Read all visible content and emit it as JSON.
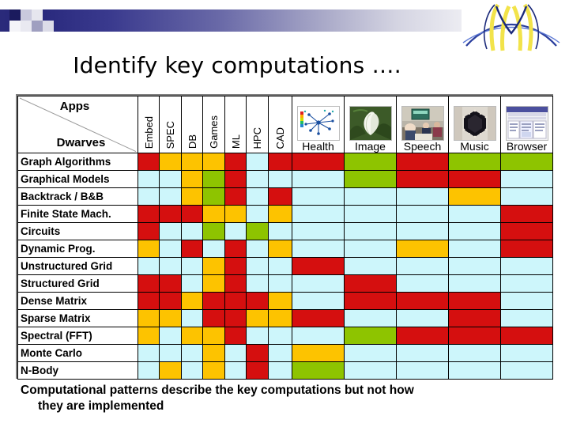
{
  "slide": {
    "title": "Identify key computations ….",
    "caption_line1": "Computational patterns describe the key computations but not how",
    "caption_line2": "they are implemented"
  },
  "table": {
    "corner": {
      "apps_label": "Apps",
      "dwarves_label": "Dwarves"
    },
    "text_columns": [
      "Embed",
      "SPEC",
      "DB",
      "Games",
      "ML",
      "HPC",
      "CAD"
    ],
    "image_columns": [
      {
        "label": "Health",
        "icon": "molecular-network-thumbnail"
      },
      {
        "label": "Image",
        "icon": "white-flower-photo-thumbnail"
      },
      {
        "label": "Speech",
        "icon": "meeting-room-photo-thumbnail"
      },
      {
        "label": "Music",
        "icon": "dark-wreath-photo-thumbnail"
      },
      {
        "label": "Browser",
        "icon": "web-browser-window-thumbnail"
      }
    ],
    "rows": [
      "Graph Algorithms",
      "Graphical Models",
      "Backtrack / B&B",
      "Finite State Mach.",
      "Circuits",
      "Dynamic Prog.",
      "Unstructured Grid",
      "Structured Grid",
      "Dense Matrix",
      "Sparse Matrix",
      "Spectral (FFT)",
      "Monte Carlo",
      "N-Body"
    ],
    "legend_colors": {
      "high": "#d50f0f",
      "medium-high": "#fdc300",
      "medium": "#8ec400",
      "low": "#cdf6fb"
    }
  },
  "chart_data": {
    "type": "heatmap",
    "title": "Identify key computations ….",
    "xlabel": "Apps",
    "ylabel": "Dwarves",
    "categories_x": [
      "Embed",
      "SPEC",
      "DB",
      "Games",
      "ML",
      "HPC",
      "CAD",
      "Health",
      "Image",
      "Speech",
      "Music",
      "Browser"
    ],
    "categories_y": [
      "Graph Algorithms",
      "Graphical Models",
      "Backtrack / B&B",
      "Finite State Mach.",
      "Circuits",
      "Dynamic Prog.",
      "Unstructured Grid",
      "Structured Grid",
      "Dense Matrix",
      "Sparse Matrix",
      "Spectral (FFT)",
      "Monte Carlo",
      "N-Body"
    ],
    "value_levels": {
      "high": "#d50f0f",
      "medium-high": "#fdc300",
      "medium": "#8ec400",
      "low": "#cdf6fb"
    },
    "legend": [
      "high",
      "medium-high",
      "medium",
      "low"
    ],
    "grid": true,
    "matrix": [
      [
        "high",
        "medium-high",
        "medium-high",
        "medium-high",
        "high",
        "low",
        "high",
        "high",
        "medium",
        "high",
        "medium",
        "medium"
      ],
      [
        "low",
        "low",
        "medium-high",
        "medium",
        "high",
        "low",
        "low",
        "low",
        "medium",
        "high",
        "high",
        "low"
      ],
      [
        "low",
        "low",
        "medium-high",
        "medium",
        "high",
        "low",
        "high",
        "low",
        "low",
        "low",
        "medium-high",
        "low"
      ],
      [
        "high",
        "high",
        "high",
        "medium-high",
        "medium-high",
        "low",
        "medium-high",
        "low",
        "low",
        "low",
        "low",
        "high"
      ],
      [
        "high",
        "low",
        "low",
        "medium",
        "low",
        "medium",
        "low",
        "low",
        "low",
        "low",
        "low",
        "high"
      ],
      [
        "medium-high",
        "low",
        "high",
        "low",
        "high",
        "low",
        "medium-high",
        "low",
        "low",
        "medium-high",
        "low",
        "high"
      ],
      [
        "low",
        "low",
        "low",
        "medium-high",
        "high",
        "low",
        "low",
        "high",
        "low",
        "low",
        "low",
        "low"
      ],
      [
        "high",
        "high",
        "low",
        "medium-high",
        "high",
        "low",
        "low",
        "low",
        "high",
        "low",
        "low",
        "low"
      ],
      [
        "high",
        "high",
        "medium-high",
        "high",
        "high",
        "high",
        "medium-high",
        "low",
        "high",
        "high",
        "high",
        "low"
      ],
      [
        "medium-high",
        "medium-high",
        "low",
        "high",
        "high",
        "medium-high",
        "medium-high",
        "high",
        "low",
        "low",
        "high",
        "low"
      ],
      [
        "medium-high",
        "low",
        "medium-high",
        "medium-high",
        "high",
        "low",
        "low",
        "low",
        "medium",
        "high",
        "high",
        "high"
      ],
      [
        "low",
        "low",
        "low",
        "medium-high",
        "low",
        "high",
        "low",
        "medium-high",
        "low",
        "low",
        "low",
        "low"
      ],
      [
        "low",
        "medium-high",
        "low",
        "medium-high",
        "low",
        "high",
        "low",
        "medium",
        "low",
        "low",
        "low",
        "low"
      ]
    ]
  }
}
